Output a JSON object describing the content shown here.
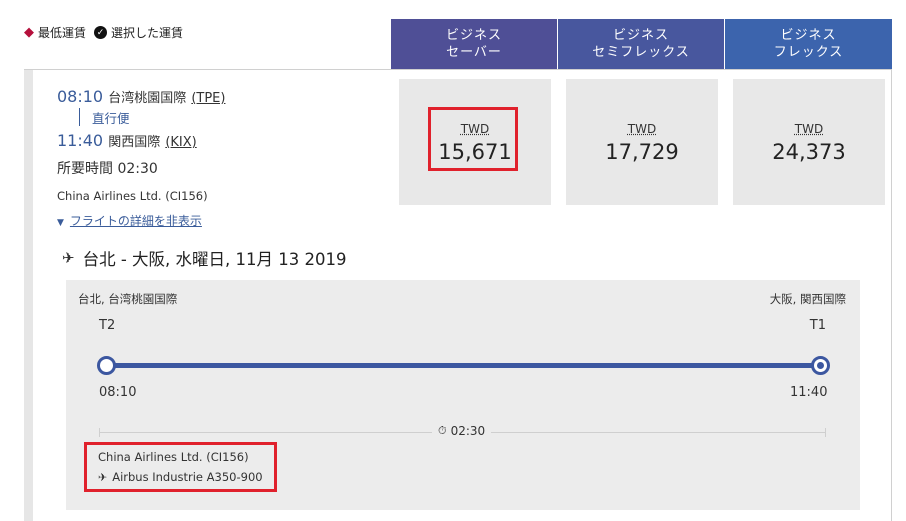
{
  "legend": {
    "lowest_fare": "最低運賃",
    "selected_fare": "選択した運賃"
  },
  "fare_headers": [
    {
      "line1": "ビジネス",
      "line2": "セーバー"
    },
    {
      "line1": "ビジネス",
      "line2": "セミフレックス"
    },
    {
      "line1": "ビジネス",
      "line2": "フレックス"
    }
  ],
  "flight": {
    "dep_time": "08:10",
    "dep_airport": "台湾桃園国際",
    "dep_code": "(TPE)",
    "stop_type": "直行便",
    "arr_time": "11:40",
    "arr_airport": "関西国際",
    "arr_code": "(KIX)",
    "duration": "所要時間 02:30",
    "carrier": "China Airlines Ltd. (CI156)",
    "details_link": "フライトの詳細を非表示"
  },
  "prices": [
    {
      "currency": "TWD",
      "amount": "15,671"
    },
    {
      "currency": "TWD",
      "amount": "17,729"
    },
    {
      "currency": "TWD",
      "amount": "24,373"
    }
  ],
  "route_header": "台北 - 大阪, 水曜日, 11月 13 2019",
  "detail": {
    "dep_city": "台北, 台湾桃園国際",
    "arr_city": "大阪, 関西国際",
    "dep_terminal": "T2",
    "arr_terminal": "T1",
    "dep_time": "08:10",
    "arr_time": "11:40",
    "duration": "02:30",
    "carrier": "China Airlines Ltd. (CI156)",
    "aircraft": "Airbus Industrie A350-900"
  },
  "colors": {
    "highlight": "#e0212c",
    "brand_blue": "#3c57a0",
    "header_saver": "#4f4f96",
    "header_semiflex": "#48579e",
    "header_flex": "#3c64ad"
  }
}
